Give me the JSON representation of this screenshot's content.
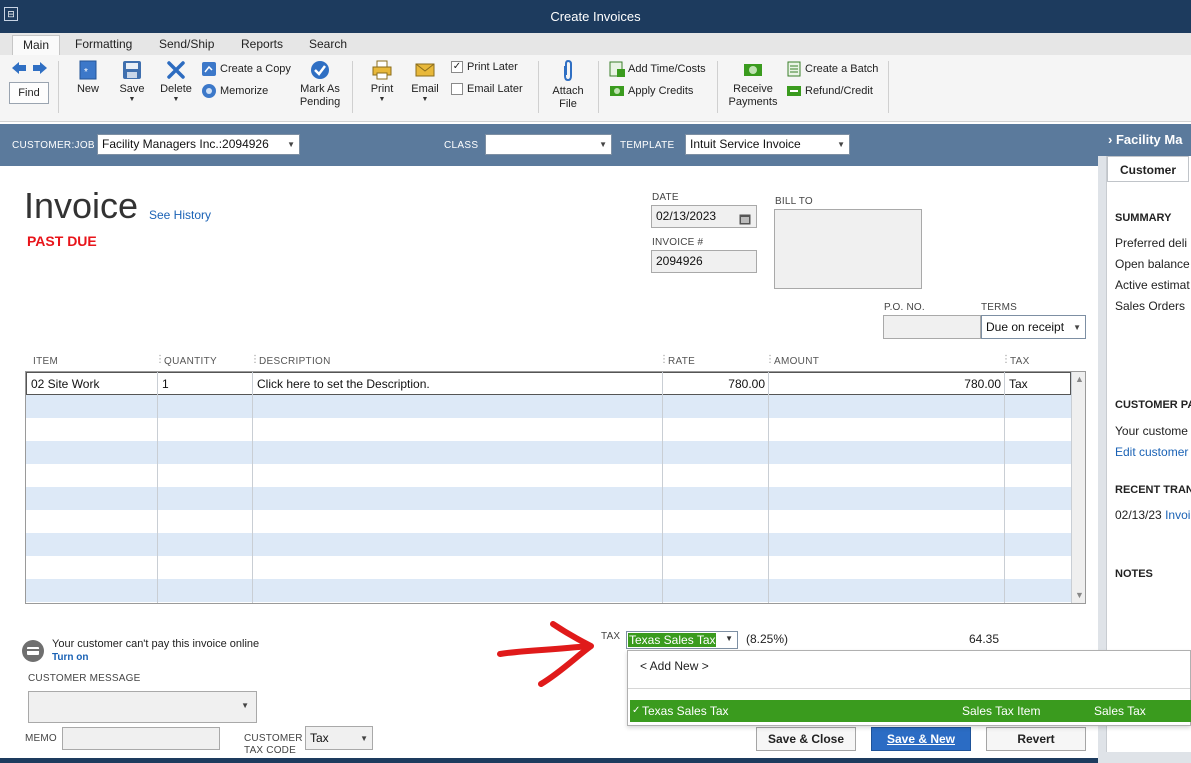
{
  "window": {
    "title": "Create Invoices",
    "sys_icon": "⊟"
  },
  "tabs": [
    "Main",
    "Formatting",
    "Send/Ship",
    "Reports",
    "Search"
  ],
  "toolbar": {
    "find": "Find",
    "new": "New",
    "save": "Save",
    "delete": "Delete",
    "create_copy": "Create a Copy",
    "memorize": "Memorize",
    "mark_as_pending_1": "Mark As",
    "mark_as_pending_2": "Pending",
    "print": "Print",
    "email": "Email",
    "print_later": "Print Later",
    "email_later": "Email Later",
    "attach_file_1": "Attach",
    "attach_file_2": "File",
    "add_time_costs": "Add Time/Costs",
    "apply_credits": "Apply Credits",
    "receive_payments_1": "Receive",
    "receive_payments_2": "Payments",
    "create_batch": "Create a Batch",
    "refund_credit": "Refund/Credit"
  },
  "customer_bar": {
    "customer_job_label": "CUSTOMER:JOB",
    "customer_job_value": "Facility Managers Inc.:2094926",
    "class_label": "CLASS",
    "class_value": "",
    "template_label": "TEMPLATE",
    "template_value": "Intuit Service Invoice"
  },
  "invoice": {
    "title": "Invoice",
    "see_history": "See History",
    "status": "PAST DUE",
    "date_label": "DATE",
    "date_value": "02/13/2023",
    "invoice_no_label": "INVOICE #",
    "invoice_no_value": "2094926",
    "bill_to_label": "BILL TO",
    "po_label": "P.O. NO.",
    "po_value": "",
    "terms_label": "TERMS",
    "terms_value": "Due on receipt"
  },
  "grid": {
    "headers": [
      "ITEM",
      "QUANTITY",
      "DESCRIPTION",
      "RATE",
      "AMOUNT",
      "TAX"
    ],
    "rows": [
      {
        "item": "02 Site Work",
        "quantity": "1",
        "description": "Click here to set the Description.",
        "rate": "780.00",
        "amount": "780.00",
        "tax": "Tax"
      }
    ]
  },
  "footer": {
    "online_pay_text": "Your customer can't pay this invoice online",
    "turn_on": "Turn on",
    "customer_message_label": "CUSTOMER MESSAGE",
    "memo_label": "MEMO",
    "customer_tax_code_label_1": "CUSTOMER",
    "customer_tax_code_label_2": "TAX CODE",
    "customer_tax_code_value": "Tax",
    "tax_label": "TAX",
    "tax_value": "Texas Sales Tax",
    "tax_rate": "(8.25%)",
    "tax_amount": "64.35",
    "save_close": "Save & Close",
    "save_new": "Save & New",
    "revert": "Revert"
  },
  "tax_dropdown": {
    "add_new": "< Add New >",
    "option_name": "Texas Sales Tax",
    "option_type": "Sales Tax Item",
    "option_desc": "Sales Tax"
  },
  "right_panel": {
    "header": "Facility Ma",
    "tab": "Customer",
    "summary": "SUMMARY",
    "preferred_delivery": "Preferred deli",
    "open_balance": "Open balance",
    "active_estimates": "Active estimat",
    "sales_orders": "Sales Orders",
    "customer_payment": "CUSTOMER PA",
    "your_customer": "Your custome",
    "edit_customer": "Edit customer",
    "recent_transactions": "RECENT TRANS",
    "recent_date": "02/13/23",
    "recent_link": "Invoi",
    "notes": "NOTES"
  },
  "colors": {
    "title_bar": "#1d3b5e",
    "customer_bar": "#5b7a9c",
    "selection_green": "#3a9b1e",
    "primary_button": "#2b6cc4",
    "past_due": "#e8141a",
    "annotation_arrow": "#e01a1a"
  }
}
